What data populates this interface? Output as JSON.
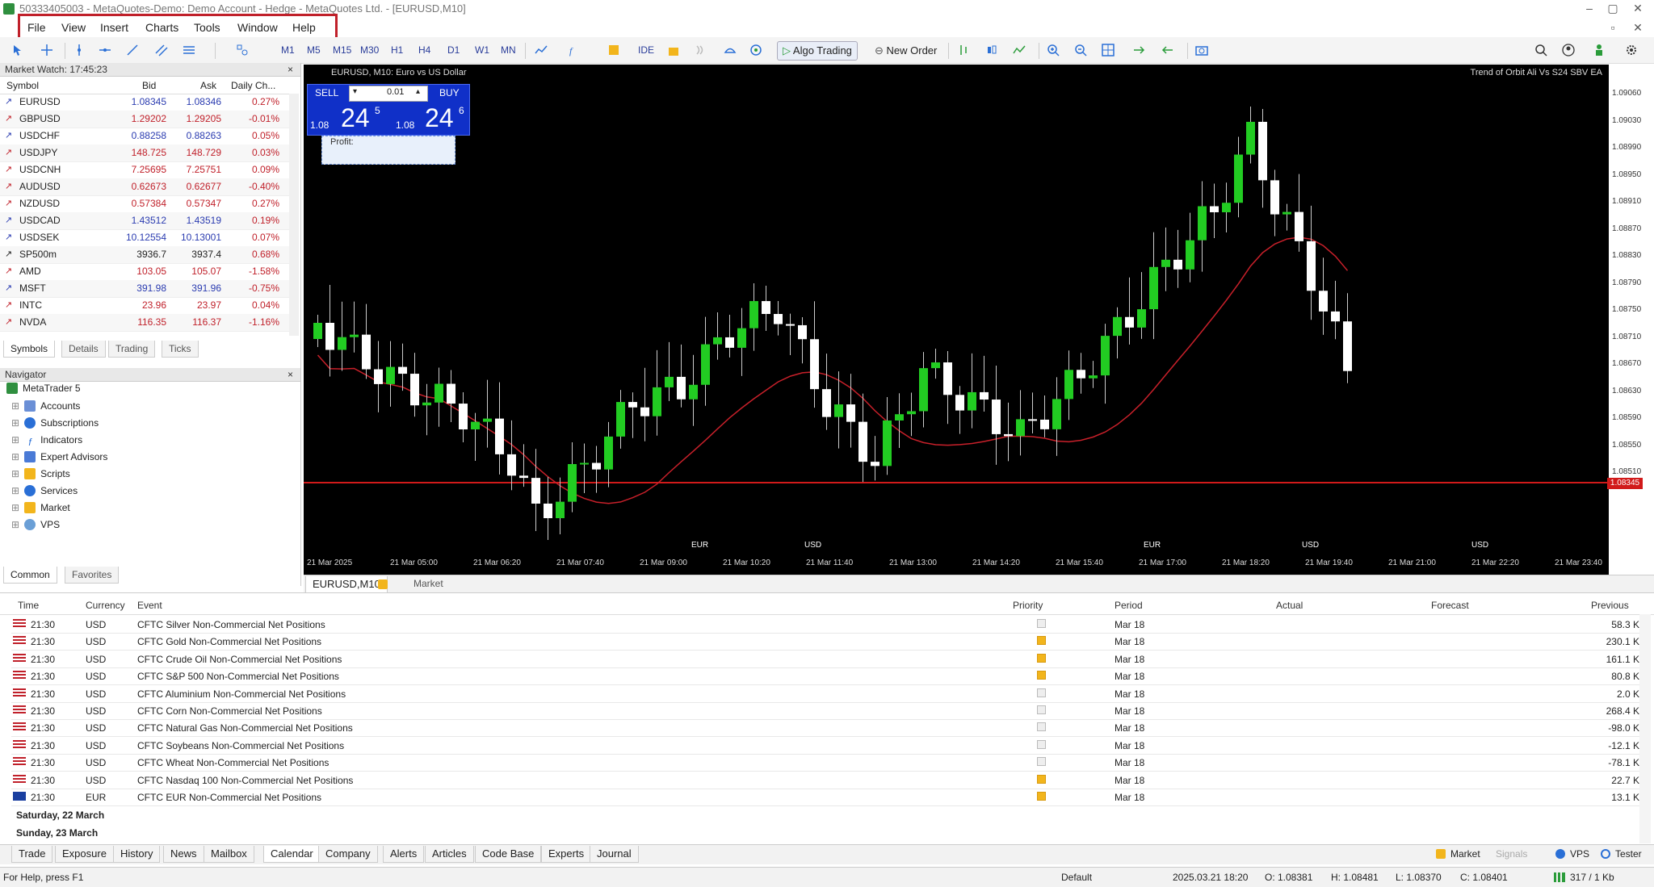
{
  "window": {
    "title": "50333405003 - MetaQuotes-Demo: Demo Account - Hedge - MetaQuotes Ltd. - [EURUSD,M10]"
  },
  "menu": [
    "File",
    "View",
    "Insert",
    "Charts",
    "Tools",
    "Window",
    "Help"
  ],
  "toolbar": {
    "timeframes": [
      "M1",
      "M5",
      "M15",
      "M30",
      "H1",
      "H4",
      "D1",
      "W1",
      "MN"
    ],
    "ide": "IDE",
    "algo_trading": "Algo Trading",
    "new_order": "New Order"
  },
  "market_watch": {
    "title": "Market Watch: 17:45:23",
    "headers": [
      "Symbol",
      "Bid",
      "Ask",
      "Daily Ch..."
    ],
    "rows": [
      {
        "symbol": "EURUSD",
        "bid": "1.08345",
        "ask": "1.08346",
        "chg": "0.27%",
        "color": "#2a3bb0"
      },
      {
        "symbol": "GBPUSD",
        "bid": "1.29202",
        "ask": "1.29205",
        "chg": "-0.01%",
        "color": "#c0202a"
      },
      {
        "symbol": "USDCHF",
        "bid": "0.88258",
        "ask": "0.88263",
        "chg": "0.05%",
        "color": "#2a3bb0"
      },
      {
        "symbol": "USDJPY",
        "bid": "148.725",
        "ask": "148.729",
        "chg": "0.03%",
        "color": "#c0202a"
      },
      {
        "symbol": "USDCNH",
        "bid": "7.25695",
        "ask": "7.25751",
        "chg": "0.09%",
        "color": "#c0202a"
      },
      {
        "symbol": "AUDUSD",
        "bid": "0.62673",
        "ask": "0.62677",
        "chg": "-0.40%",
        "color": "#c0202a"
      },
      {
        "symbol": "NZDUSD",
        "bid": "0.57384",
        "ask": "0.57347",
        "chg": "0.27%",
        "color": "#c0202a"
      },
      {
        "symbol": "USDCAD",
        "bid": "1.43512",
        "ask": "1.43519",
        "chg": "0.19%",
        "color": "#2a3bb0"
      },
      {
        "symbol": "USDSEK",
        "bid": "10.12554",
        "ask": "10.13001",
        "chg": "0.07%",
        "color": "#2a3bb0"
      },
      {
        "symbol": "SP500m",
        "bid": "3936.7",
        "ask": "3937.4",
        "chg": "0.68%",
        "color": "#222222"
      },
      {
        "symbol": "AMD",
        "bid": "103.05",
        "ask": "105.07",
        "chg": "-1.58%",
        "color": "#c0202a"
      },
      {
        "symbol": "MSFT",
        "bid": "391.98",
        "ask": "391.96",
        "chg": "-0.75%",
        "color": "#2a3bb0"
      },
      {
        "symbol": "INTC",
        "bid": "23.96",
        "ask": "23.97",
        "chg": "0.04%",
        "color": "#c0202a"
      },
      {
        "symbol": "NVDA",
        "bid": "116.35",
        "ask": "116.37",
        "chg": "-1.16%",
        "color": "#c0202a"
      }
    ],
    "tabs": [
      "Symbols",
      "Details",
      "Trading",
      "Ticks"
    ]
  },
  "navigator": {
    "title": "Navigator",
    "items": [
      "MetaTrader 5",
      "Accounts",
      "Subscriptions",
      "Indicators",
      "Expert Advisors",
      "Scripts",
      "Services",
      "Market",
      "VPS"
    ],
    "tabs": [
      "Common",
      "Favorites"
    ]
  },
  "chart": {
    "title": "EURUSD, M10: Euro vs US Dollar",
    "right_label": "Trend of Orbit Ali Vs S24 SBV EA",
    "sell": "SELL",
    "buy": "BUY",
    "lot": "0.01",
    "sell_price_small": "1.08",
    "sell_price_big": "24",
    "sell_price_sup": "5",
    "buy_price_small": "1.08",
    "buy_price_big": "24",
    "buy_price_sup": "6",
    "profit_label": "Profit:",
    "price_ticks": [
      "1.09060",
      "1.09030",
      "1.08990",
      "1.08950",
      "1.08910",
      "1.08870",
      "1.08830",
      "1.08790",
      "1.08750",
      "1.08710",
      "1.08670",
      "1.08630",
      "1.08590",
      "1.08550",
      "1.08510"
    ],
    "current_price": "1.08345",
    "time_labels": [
      "21 Mar 2025",
      "21 Mar 05:00",
      "21 Mar 06:20",
      "21 Mar 07:40",
      "21 Mar 09:00",
      "21 Mar 10:20",
      "21 Mar 11:40",
      "21 Mar 13:00",
      "21 Mar 14:20",
      "21 Mar 15:40",
      "21 Mar 17:00",
      "21 Mar 18:20",
      "21 Mar 19:40",
      "21 Mar 21:00",
      "21 Mar 22:20",
      "21 Mar 23:40"
    ],
    "flags": [
      "EUR",
      "USD",
      "EUR",
      "USD",
      "USD"
    ],
    "tabs": [
      "EURUSD,M10",
      "Market"
    ]
  },
  "calendar": {
    "headers": [
      "Time",
      "Currency",
      "Event",
      "Priority",
      "Period",
      "Actual",
      "Forecast",
      "Previous"
    ],
    "rows": [
      {
        "time": "21:30",
        "cur": "USD",
        "event": "CFTC Silver Non-Commercial Net Positions",
        "prio": "low",
        "period": "Mar 18",
        "actual": "",
        "forecast": "",
        "prev": "58.3 K"
      },
      {
        "time": "21:30",
        "cur": "USD",
        "event": "CFTC Gold Non-Commercial Net Positions",
        "prio": "high",
        "period": "Mar 18",
        "actual": "",
        "forecast": "",
        "prev": "230.1 K"
      },
      {
        "time": "21:30",
        "cur": "USD",
        "event": "CFTC Crude Oil Non-Commercial Net Positions",
        "prio": "high",
        "period": "Mar 18",
        "actual": "",
        "forecast": "",
        "prev": "161.1 K"
      },
      {
        "time": "21:30",
        "cur": "USD",
        "event": "CFTC S&P 500 Non-Commercial Net Positions",
        "prio": "high",
        "period": "Mar 18",
        "actual": "",
        "forecast": "",
        "prev": "80.8 K"
      },
      {
        "time": "21:30",
        "cur": "USD",
        "event": "CFTC Aluminium Non-Commercial Net Positions",
        "prio": "low",
        "period": "Mar 18",
        "actual": "",
        "forecast": "",
        "prev": "2.0 K"
      },
      {
        "time": "21:30",
        "cur": "USD",
        "event": "CFTC Corn Non-Commercial Net Positions",
        "prio": "low",
        "period": "Mar 18",
        "actual": "",
        "forecast": "",
        "prev": "268.4 K"
      },
      {
        "time": "21:30",
        "cur": "USD",
        "event": "CFTC Natural Gas Non-Commercial Net Positions",
        "prio": "low",
        "period": "Mar 18",
        "actual": "",
        "forecast": "",
        "prev": "-98.0 K"
      },
      {
        "time": "21:30",
        "cur": "USD",
        "event": "CFTC Soybeans Non-Commercial Net Positions",
        "prio": "low",
        "period": "Mar 18",
        "actual": "",
        "forecast": "",
        "prev": "-12.1 K"
      },
      {
        "time": "21:30",
        "cur": "USD",
        "event": "CFTC Wheat Non-Commercial Net Positions",
        "prio": "low",
        "period": "Mar 18",
        "actual": "",
        "forecast": "",
        "prev": "-78.1 K"
      },
      {
        "time": "21:30",
        "cur": "USD",
        "event": "CFTC Nasdaq 100 Non-Commercial Net Positions",
        "prio": "high",
        "period": "Mar 18",
        "actual": "",
        "forecast": "",
        "prev": "22.7 K"
      },
      {
        "time": "21:30",
        "cur": "EUR",
        "event": "CFTC EUR Non-Commercial Net Positions",
        "prio": "high",
        "period": "Mar 18",
        "actual": "",
        "forecast": "",
        "prev": "13.1 K"
      }
    ],
    "groups": [
      "Saturday, 22 March",
      "Sunday, 23 March"
    ]
  },
  "bottom_tabs": [
    "Trade",
    "Exposure",
    "History",
    "News",
    "Mailbox",
    "Calendar",
    "Company",
    "Alerts",
    "Articles",
    "Code Base",
    "Experts",
    "Journal"
  ],
  "bottom_right": {
    "market": "Market",
    "signals": "Signals",
    "vps": "VPS",
    "tester": "Tester"
  },
  "status": {
    "help": "For Help, press F1",
    "profile": "Default",
    "datetime": "2025.03.21 18:20",
    "open": "O: 1.08381",
    "high": "H: 1.08481",
    "low": "L: 1.08370",
    "close": "C: 1.08401",
    "traffic": "317 / 1 Kb"
  },
  "colors": {
    "bull": "#22cc22",
    "bear": "#ffffff",
    "ma": "#c8202a",
    "price_line": "#d11a1a",
    "chart_bg": "#000000",
    "highlight": "#c0202a"
  }
}
